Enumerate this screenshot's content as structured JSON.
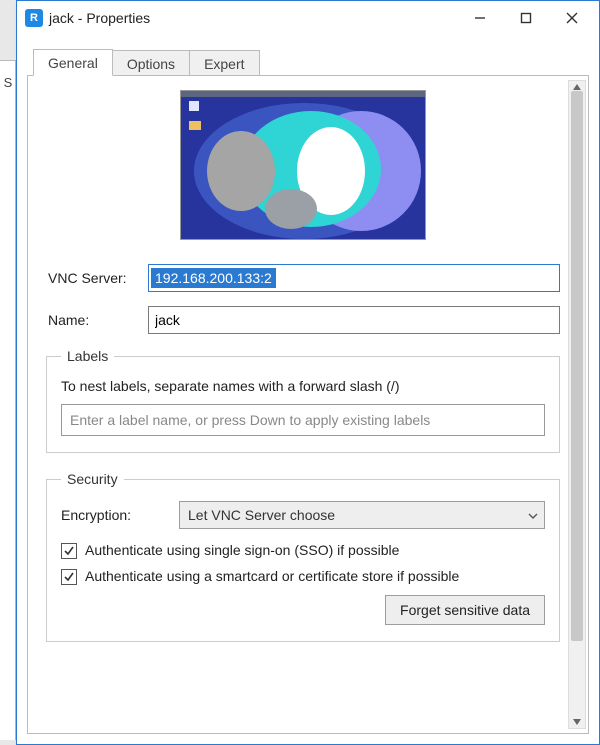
{
  "window": {
    "title": "jack - Properties"
  },
  "tabs": {
    "general": "General",
    "options": "Options",
    "expert": "Expert",
    "active": "general"
  },
  "form": {
    "vnc_server_label": "VNC Server:",
    "vnc_server_value": "192.168.200.133:2",
    "name_label": "Name:",
    "name_value": "jack"
  },
  "labels_group": {
    "legend": "Labels",
    "hint": "To nest labels, separate names with a forward slash (/)",
    "placeholder": "Enter a label name, or press Down to apply existing labels",
    "value": ""
  },
  "security_group": {
    "legend": "Security",
    "encryption_label": "Encryption:",
    "encryption_value": "Let VNC Server choose",
    "sso_label": "Authenticate using single sign-on (SSO) if possible",
    "sso_checked": true,
    "smartcard_label": "Authenticate using a smartcard or certificate store if possible",
    "smartcard_checked": true,
    "forget_button": "Forget sensitive data"
  }
}
